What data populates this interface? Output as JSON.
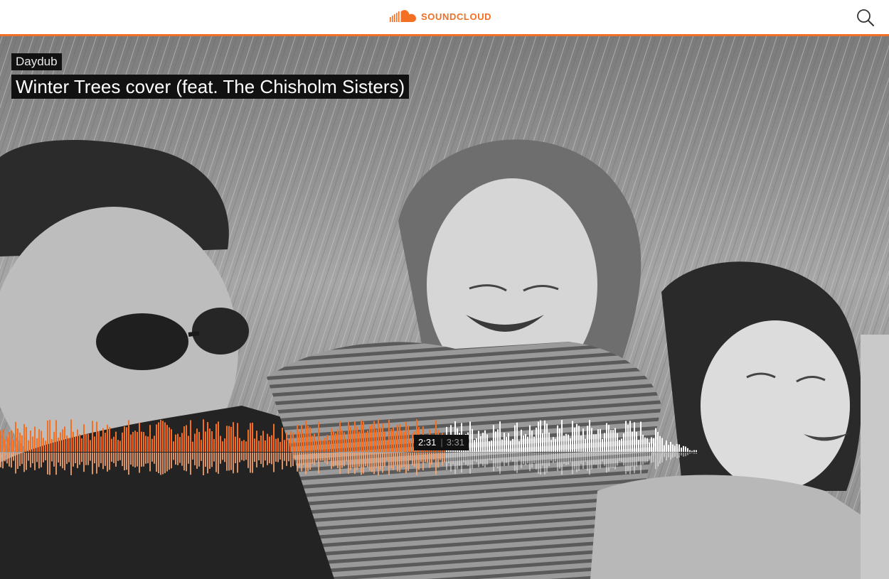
{
  "header": {
    "brand": "SOUNDCLOUD",
    "logo_icon": "soundcloud-cloud-icon",
    "search_icon": "search-icon"
  },
  "track": {
    "artist": "Daydub",
    "title": "Winter Trees cover (feat. The Chisholm Sisters)"
  },
  "player": {
    "current_time": "2:31",
    "separator": "|",
    "total_time": "3:31",
    "progress_fraction": 0.716
  },
  "colors": {
    "accent": "#f26f23",
    "played_wave": "#f26f23",
    "played_reflection": "#f7a773",
    "unplayed_wave": "#ffffff",
    "label_bg": "#111111"
  }
}
